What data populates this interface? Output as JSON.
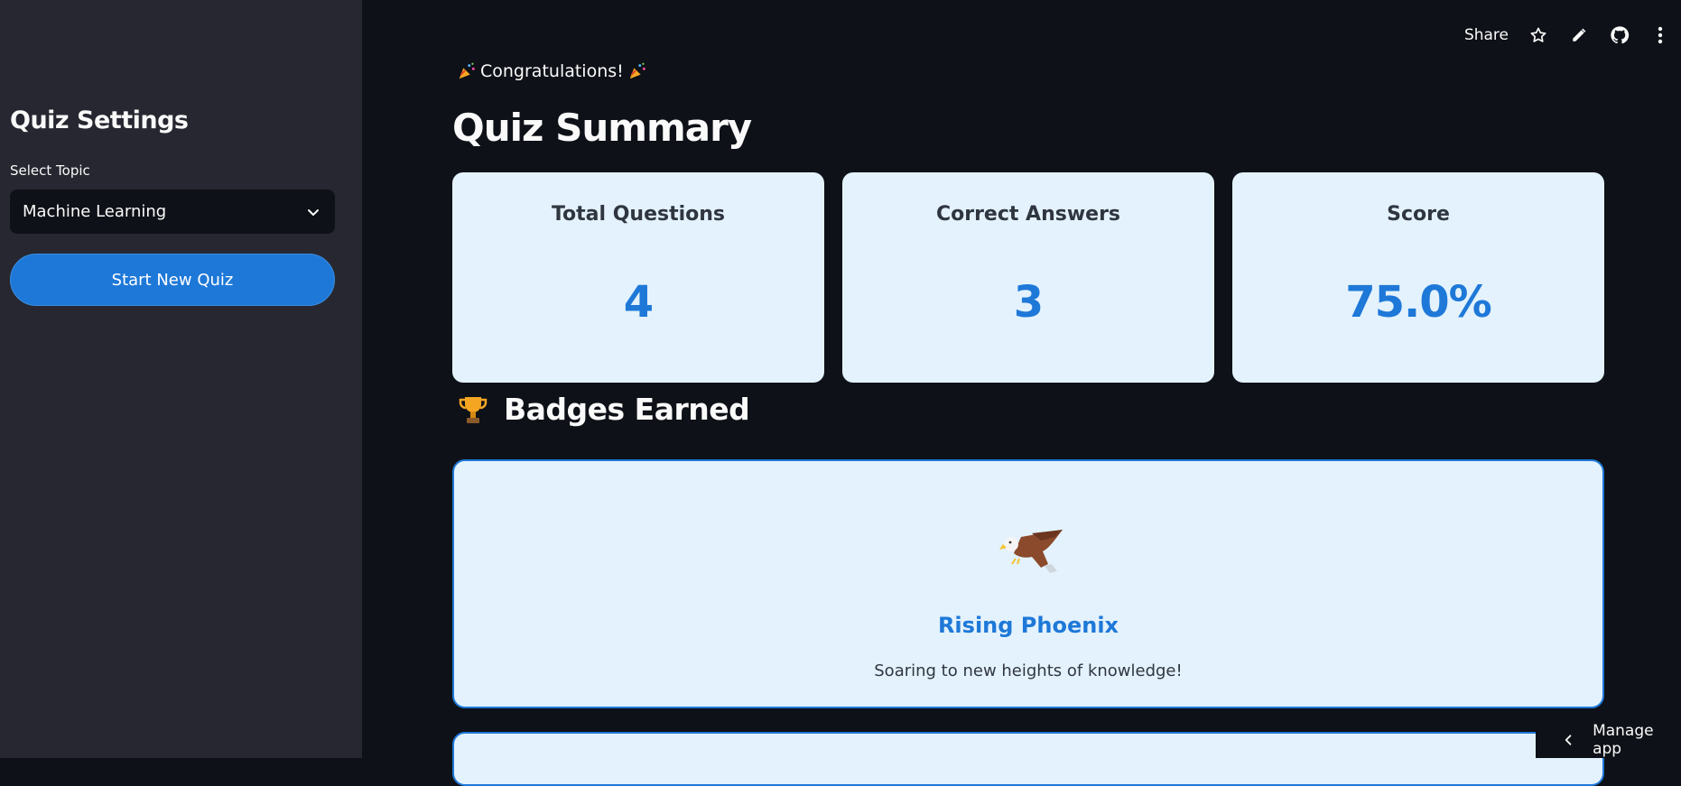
{
  "sidebar": {
    "title": "Quiz Settings",
    "select_label": "Select Topic",
    "selected_topic": "Machine Learning",
    "start_button": "Start New Quiz"
  },
  "toolbar": {
    "share_label": "Share",
    "icons": [
      "star-icon",
      "edit-icon",
      "github-icon",
      "more-vertical-icon"
    ]
  },
  "main": {
    "congrats_text": "Congratulations!",
    "title": "Quiz Summary",
    "stats": [
      {
        "label": "Total Questions",
        "value": "4"
      },
      {
        "label": "Correct Answers",
        "value": "3"
      },
      {
        "label": "Score",
        "value": "75.0%"
      }
    ],
    "badges_heading": "Badges Earned",
    "badges": [
      {
        "icon": "eagle-icon",
        "name": "Rising Phoenix",
        "description": "Soaring to new heights of knowledge!"
      }
    ]
  },
  "footer": {
    "manage_app_label": "Manage app"
  },
  "colors": {
    "accent": "#1e78d8",
    "card_bg": "#e3f2fd",
    "sidebar_bg": "#262730",
    "main_bg": "#0e1117"
  }
}
